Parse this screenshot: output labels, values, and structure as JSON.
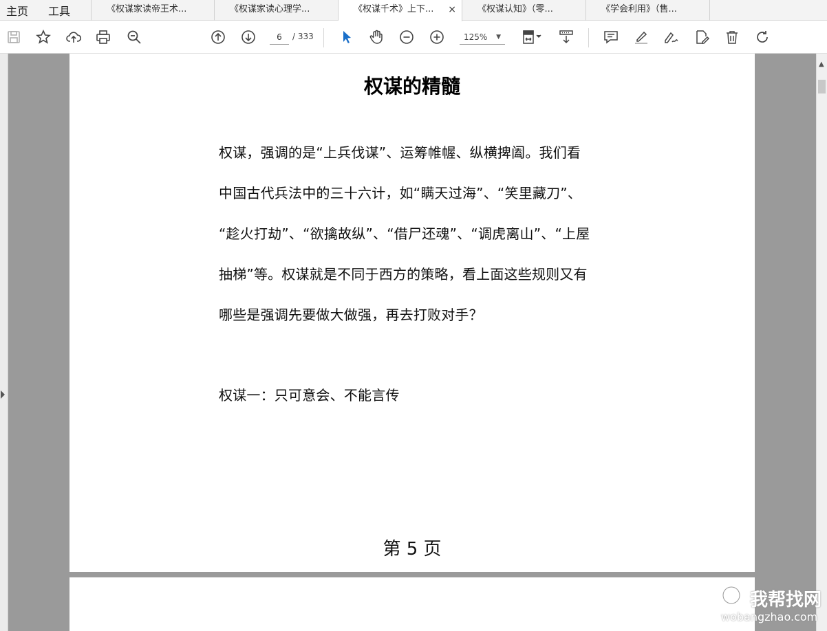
{
  "menu": {
    "home": "主页",
    "tools": "工具"
  },
  "tabs": [
    {
      "label": "《权谋家读帝王术...",
      "active": false
    },
    {
      "label": "《权谋家读心理学...",
      "active": false
    },
    {
      "label": "《权谋千术》上下...",
      "active": true
    },
    {
      "label": "《权谋认知》（零...",
      "active": false
    },
    {
      "label": "《学会利用》（售...",
      "active": false
    }
  ],
  "tab_close_icon": "×",
  "toolbar": {
    "current_page": "6",
    "total_pages": "/ 333",
    "zoom": "125%",
    "icons": [
      "save-icon",
      "bookmark-star-icon",
      "upload-cloud-icon",
      "print-icon",
      "zoom-search-icon",
      "page-up-icon",
      "page-down-icon",
      "select-cursor-icon",
      "hand-tool-icon",
      "zoom-out-icon",
      "zoom-in-icon",
      "fit-page-icon",
      "scroll-mode-icon",
      "comment-icon",
      "highlight-icon",
      "sign-icon",
      "fill-sign-icon",
      "delete-icon",
      "rotate-icon"
    ]
  },
  "document": {
    "title": "权谋的精髓",
    "paragraph_lines": [
      "权谋，强调的是“上兵伐谋”、运筹帷幄、纵横捭阖。我们看",
      "中国古代兵法中的三十六计，如“瞒天过海”、“笑里藏刀”、",
      "“趁火打劫”、“欲擒故纵”、“借尸还魂”、“调虎离山”、“上屋",
      "抽梯”等。权谋就是不同于西方的策略，看上面这些规则又有",
      "哪些是强调先要做大做强，再去打败对手？"
    ],
    "section_heading": "权谋一：只可意会、不能言传",
    "page_label": "第 5 页"
  },
  "watermark": {
    "cn": "我帮找网",
    "en": "wobangzhao.com"
  },
  "colors": {
    "accent": "#1a6fc9",
    "page_bg": "#9a9a9a"
  }
}
